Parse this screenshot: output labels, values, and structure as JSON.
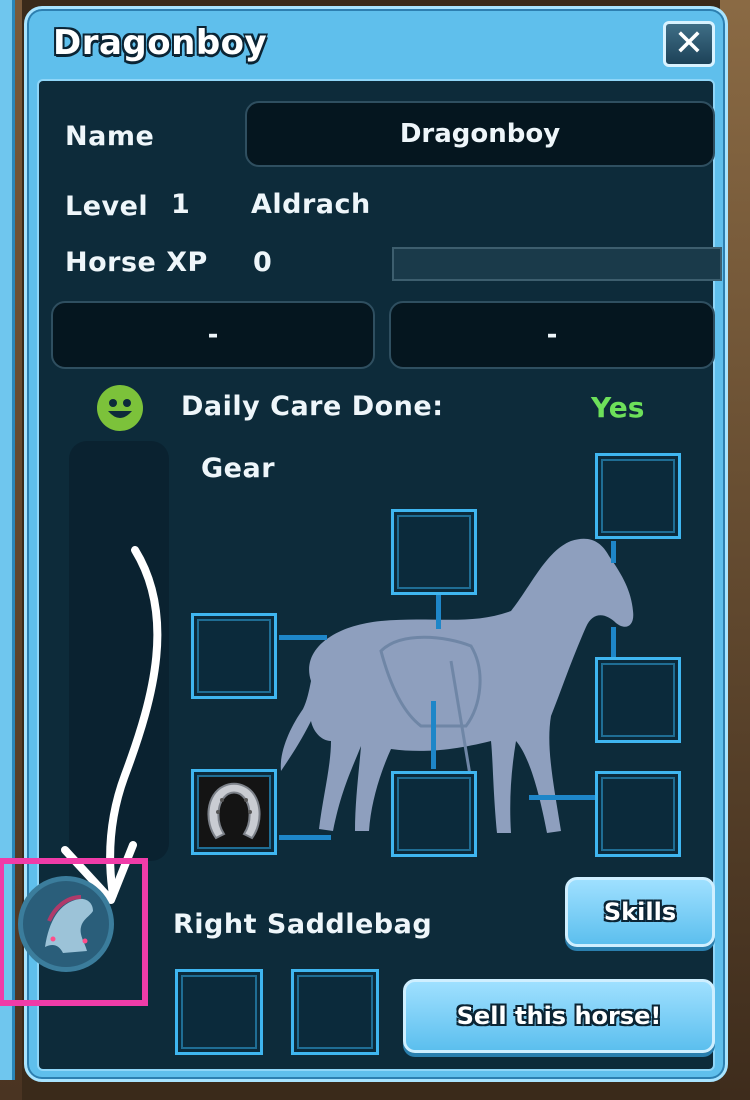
{
  "window": {
    "title": "Dragonboy",
    "close_glyph": "✕"
  },
  "info": {
    "name_label": "Name",
    "name_value": "Dragonboy",
    "level_label": "Level",
    "level_value": "1",
    "breed": "Aldrach",
    "xp_label": "Horse XP",
    "xp_value": "0",
    "xp_progress": 0,
    "field_left": "-",
    "field_right": "-"
  },
  "care": {
    "label": "Daily Care Done:",
    "value": "Yes",
    "mood_icon": "smiley-icon",
    "mood_color": "#7cc23a",
    "value_color": "#6de05a"
  },
  "gear": {
    "label": "Gear",
    "slots": [
      {
        "id": "head",
        "item": ""
      },
      {
        "id": "saddle",
        "item": ""
      },
      {
        "id": "blanket",
        "item": ""
      },
      {
        "id": "neck",
        "item": ""
      },
      {
        "id": "hoof",
        "item": "horseshoe-icon"
      },
      {
        "id": "legs",
        "item": ""
      },
      {
        "id": "rear-legs",
        "item": ""
      }
    ]
  },
  "saddlebag": {
    "label": "Right Saddlebag",
    "slots": [
      "",
      ""
    ]
  },
  "buttons": {
    "skills": "Skills",
    "sell": "Sell this horse!"
  },
  "annotation": {
    "highlight_color": "#f03ca8",
    "arrow_icon": "curved-arrow-down-icon",
    "badge_icon": "horse-head-badge-icon"
  },
  "colors": {
    "panel_frame": "#5fbfec",
    "panel_inner": "#0d2b3a",
    "slot_border": "#3fb6f0"
  }
}
